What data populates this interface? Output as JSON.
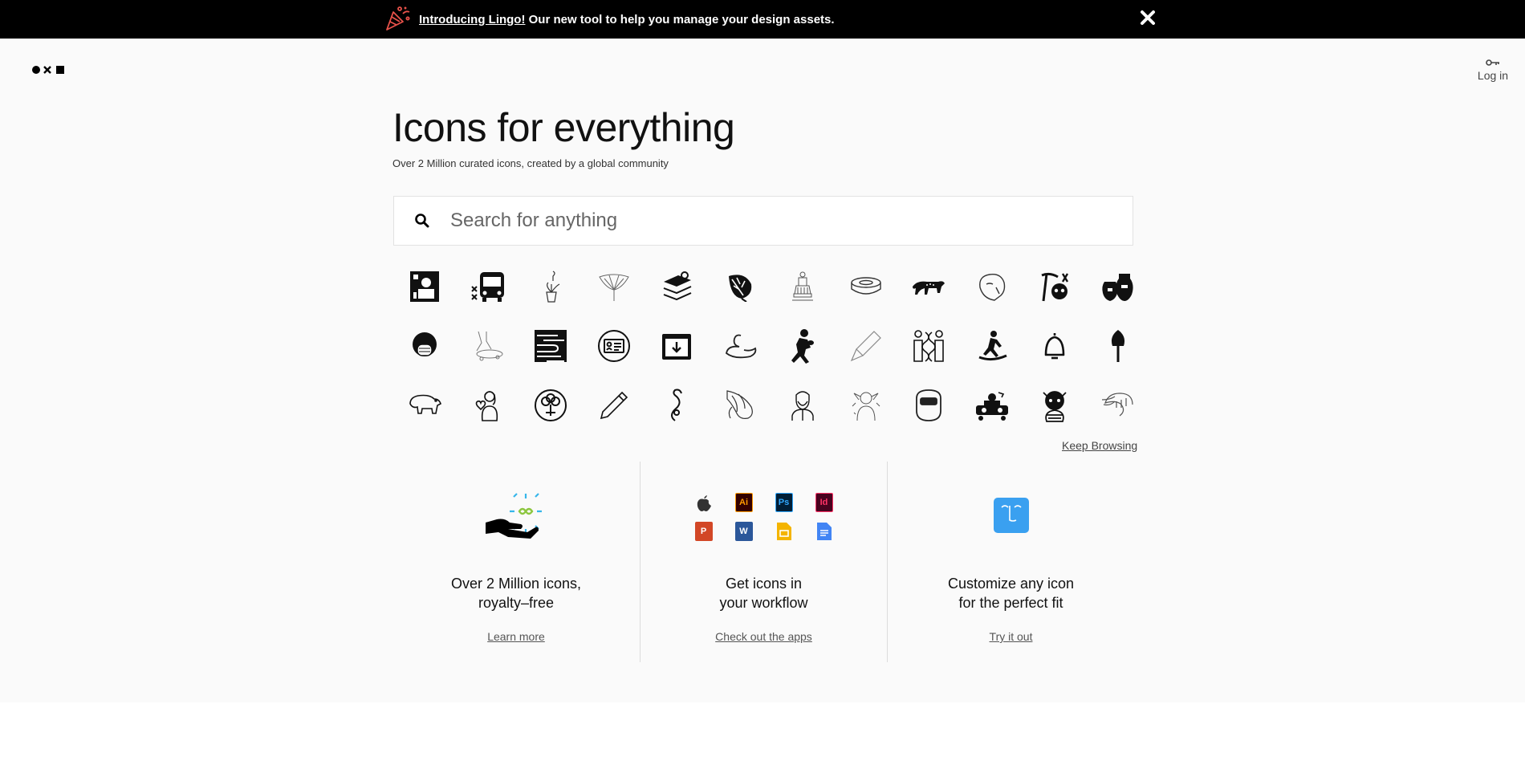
{
  "banner": {
    "link_text": "Introducing Lingo!",
    "text": " Our new tool to help you manage your design assets.",
    "icon": "party-popper-icon",
    "close_icon": "close-icon"
  },
  "header": {
    "logo_icon": "noun-project-logo-icon",
    "login_label": "Log in",
    "login_icon": "key-icon"
  },
  "hero": {
    "title": "Icons for everything",
    "subtitle": "Over 2 Million curated icons, created by a global community"
  },
  "search": {
    "placeholder": "Search for anything",
    "value": "",
    "icon": "search-icon"
  },
  "icon_grid": [
    [
      "presenter-icon",
      "bus-icon",
      "hanging-plant-icon",
      "ginkgo-leaf-icon",
      "layers-icon",
      "monstera-leaf-icon",
      "statue-icon",
      "tape-roll-icon",
      "leopard-icon",
      "rock-face-icon",
      "mining-skull-icon",
      "vases-icon"
    ],
    [
      "face-mask-person-icon",
      "skateboard-trick-icon",
      "wood-grain-icon",
      "id-card-icon",
      "archive-box-icon",
      "swan-icon",
      "football-player-icon",
      "highlighter-icon",
      "dna-couple-icon",
      "snowboarder-icon",
      "bell-icon",
      "shovel-icon"
    ],
    [
      "bear-icon",
      "woman-heart-icon",
      "tree-emblem-icon",
      "pencil-icon",
      "sprout-icon",
      "dancers-icon",
      "bearded-man-icon",
      "elf-icon",
      "welding-mask-icon",
      "dj-booth-icon",
      "red-panda-icon",
      "shrimp-icon"
    ]
  ],
  "keep_browsing_label": "Keep Browsing",
  "features": [
    {
      "icon": "hand-infinity-icon",
      "title_line1": "Over 2 Million icons,",
      "title_line2": "royalty–free",
      "link": "Learn more",
      "colors": {
        "accent_blue": "#36b6ea",
        "accent_green": "#8cc63f"
      }
    },
    {
      "icon": "app-integrations-icon",
      "title_line1": "Get icons in",
      "title_line2": "your workflow",
      "link": "Check out the apps",
      "apps": [
        {
          "name": "apple-icon",
          "label": "",
          "bg": "",
          "fg": "#333333"
        },
        {
          "name": "illustrator-icon",
          "label": "Ai",
          "bg": "#330000",
          "fg": "#ff9a00"
        },
        {
          "name": "photoshop-icon",
          "label": "Ps",
          "bg": "#001e36",
          "fg": "#31a8ff"
        },
        {
          "name": "indesign-icon",
          "label": "Id",
          "bg": "#49021f",
          "fg": "#ff3366"
        },
        {
          "name": "powerpoint-icon",
          "label": "P",
          "bg": "#d24726",
          "fg": "#ffffff"
        },
        {
          "name": "word-icon",
          "label": "W",
          "bg": "#2b579a",
          "fg": "#ffffff"
        },
        {
          "name": "google-slides-icon",
          "label": "",
          "bg": "#f4b400",
          "fg": "#ffffff"
        },
        {
          "name": "google-docs-icon",
          "label": "",
          "bg": "#4285f4",
          "fg": "#ffffff"
        }
      ]
    },
    {
      "icon": "customize-face-icon",
      "title_line1": "Customize any icon",
      "title_line2": "for the perfect fit",
      "link": "Try it out",
      "colors": {
        "tile": "#3aa0f0"
      }
    }
  ]
}
